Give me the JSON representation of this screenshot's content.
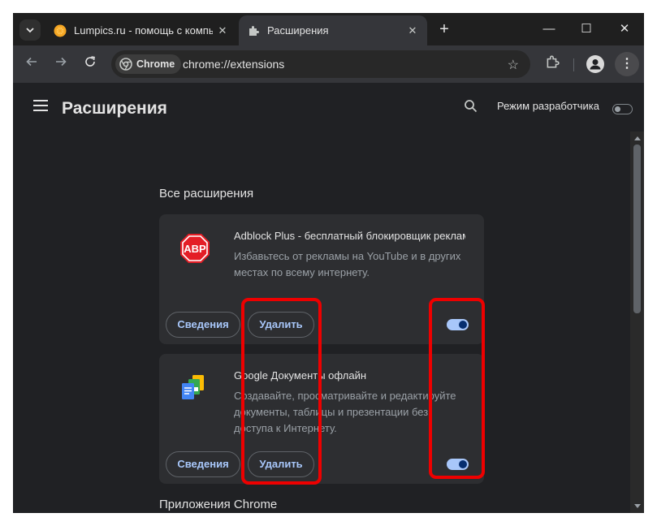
{
  "tabs": [
    {
      "title": "Lumpics.ru - помощь с компьютером",
      "close": "✕"
    },
    {
      "title": "Расширения",
      "close": "✕"
    }
  ],
  "new_tab": "+",
  "window_controls": {
    "minimize": "—",
    "maximize": "☐",
    "close": "✕"
  },
  "omnibox": {
    "chip_label": "Chrome",
    "url": "chrome://extensions"
  },
  "page": {
    "title": "Расширения",
    "dev_mode_label": "Режим разработчика",
    "dev_mode_enabled": false
  },
  "sections": {
    "all_extensions": "Все расширения",
    "chrome_apps": "Приложения Chrome"
  },
  "extensions": [
    {
      "name": "Adblock Plus - бесплатный блокировщик рекламы",
      "description": "Избавьтесь от рекламы на YouTube и в других местах по всему интернету.",
      "icon": "abp-stop-sign-icon",
      "icon_text": "ABP",
      "details_label": "Сведения",
      "remove_label": "Удалить",
      "enabled": true
    },
    {
      "name": "Google Документы офлайн",
      "description": "Создавайте, просматривайте и редактируйте документы, таблицы и презентации без доступа к Интернету.",
      "icon": "google-docs-offline-icon",
      "details_label": "Сведения",
      "remove_label": "Удалить",
      "enabled": true
    }
  ],
  "colors": {
    "background": "#202124",
    "card": "#2d2e31",
    "accent": "#a8c7fa",
    "highlight": "#ee0000"
  }
}
